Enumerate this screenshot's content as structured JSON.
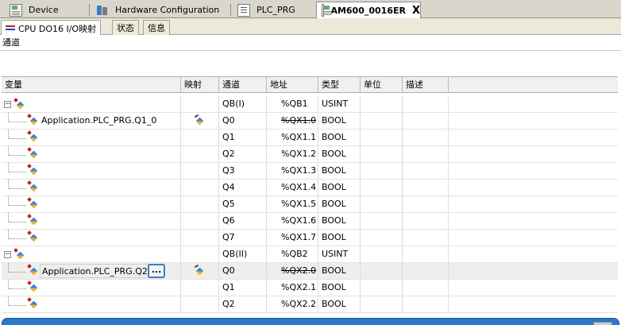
{
  "editor_tabs": [
    {
      "label": "Device",
      "icon": "device-icon"
    },
    {
      "label": "Hardware Configuration",
      "icon": "hardware-icon"
    },
    {
      "label": "PLC_PRG",
      "icon": "program-icon"
    },
    {
      "label": "AM600_0016ER",
      "icon": "device-icon",
      "close": "X"
    }
  ],
  "sub_tabs": [
    {
      "label": "CPU DO16 I/O映射"
    },
    {
      "label": "状态"
    },
    {
      "label": "信息"
    }
  ],
  "channel_header": "通道",
  "columns": [
    "变量",
    "映射",
    "通道",
    "地址",
    "类型",
    "单位",
    "描述"
  ],
  "rows": [
    {
      "variable": "",
      "channel": "QB(I)",
      "address": "%QB1",
      "type": "USINT"
    },
    {
      "variable": "Application.PLC_PRG.Q1_0",
      "channel": "Q0",
      "address": "%QX1.0",
      "type": "BOOL"
    },
    {
      "variable": "",
      "channel": "Q1",
      "address": "%QX1.1",
      "type": "BOOL"
    },
    {
      "variable": "",
      "channel": "Q2",
      "address": "%QX1.2",
      "type": "BOOL"
    },
    {
      "variable": "",
      "channel": "Q3",
      "address": "%QX1.3",
      "type": "BOOL"
    },
    {
      "variable": "",
      "channel": "Q4",
      "address": "%QX1.4",
      "type": "BOOL"
    },
    {
      "variable": "",
      "channel": "Q5",
      "address": "%QX1.5",
      "type": "BOOL"
    },
    {
      "variable": "",
      "channel": "Q6",
      "address": "%QX1.6",
      "type": "BOOL"
    },
    {
      "variable": "",
      "channel": "Q7",
      "address": "%QX1.7",
      "type": "BOOL"
    },
    {
      "variable": "",
      "channel": "QB(II)",
      "address": "%QB2",
      "type": "USINT"
    },
    {
      "variable": "Application.PLC_PRG.Q2",
      "channel": "Q0",
      "address": "%QX2.0",
      "type": "BOOL"
    },
    {
      "variable": "",
      "channel": "Q1",
      "address": "%QX2.1",
      "type": "BOOL"
    },
    {
      "variable": "",
      "channel": "Q2",
      "address": "%QX2.2",
      "type": "BOOL"
    }
  ],
  "ellipsis_label": "..."
}
